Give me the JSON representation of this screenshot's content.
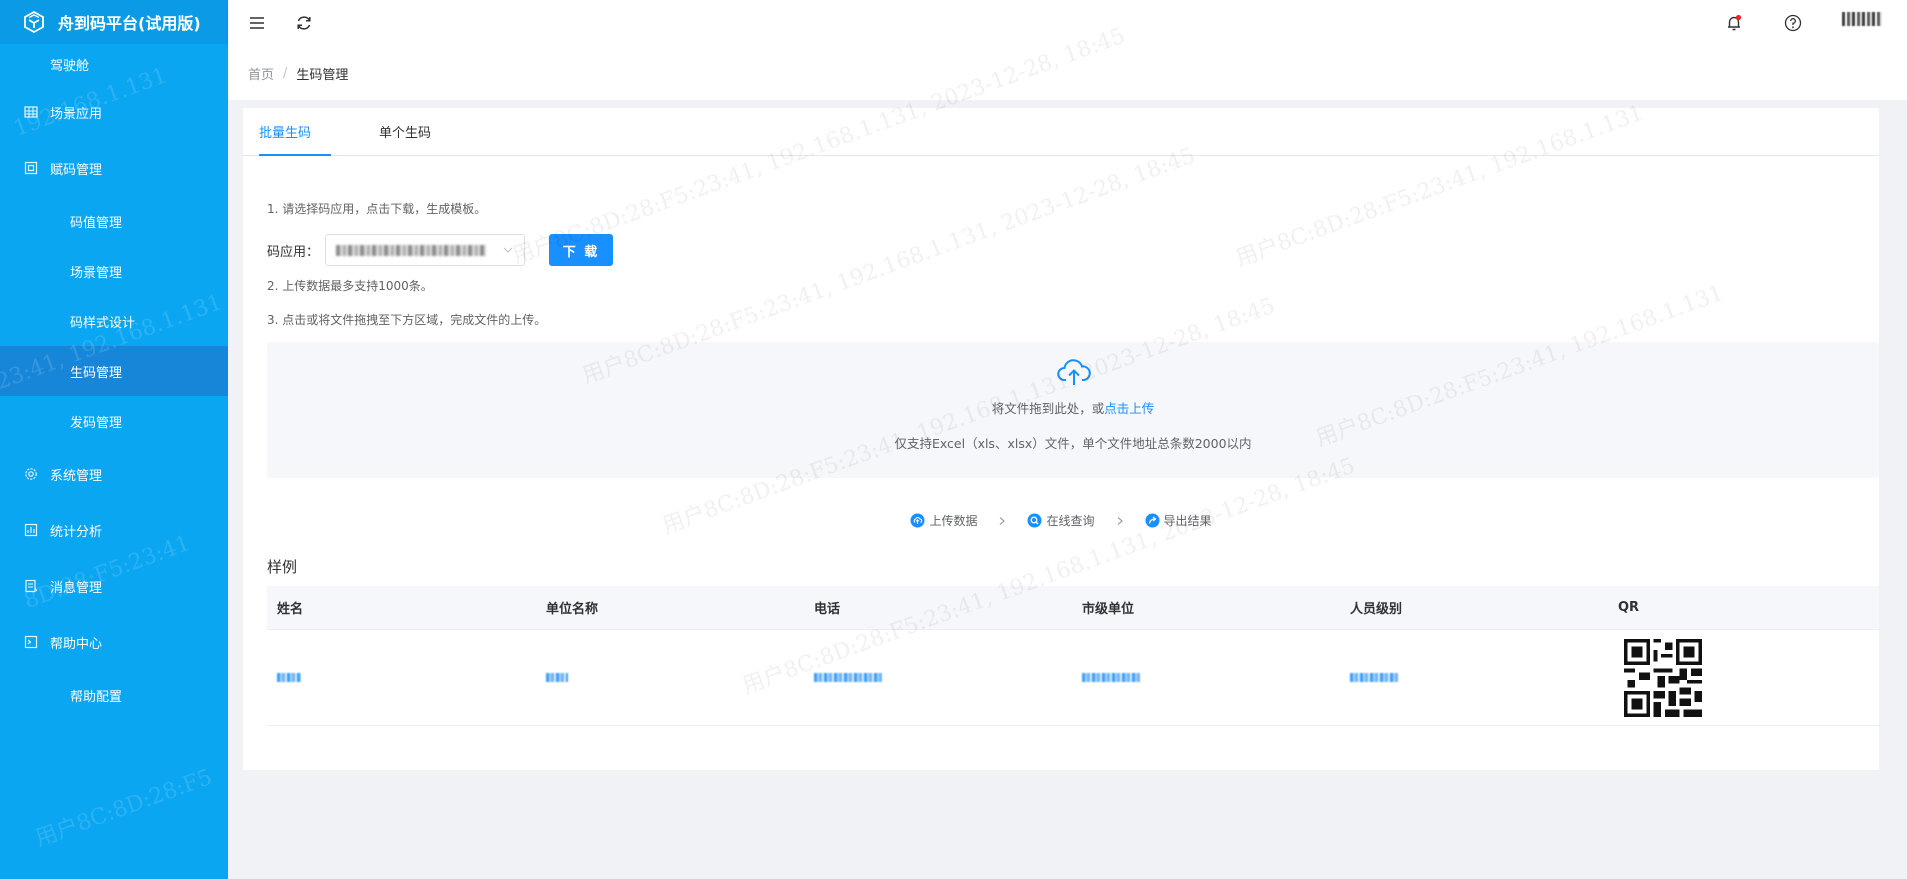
{
  "app": {
    "title": "舟到码平台(试用版)"
  },
  "sidebar": {
    "items": [
      {
        "label": "驾驶舱",
        "level": "top",
        "icon": "none"
      },
      {
        "label": "场景应用",
        "level": "root",
        "icon": "grid-icon"
      },
      {
        "label": "赋码管理",
        "level": "root",
        "icon": "square-icon"
      },
      {
        "label": "码值管理",
        "level": "sub"
      },
      {
        "label": "场景管理",
        "level": "sub"
      },
      {
        "label": "码样式设计",
        "level": "sub"
      },
      {
        "label": "生码管理",
        "level": "sub",
        "active": true
      },
      {
        "label": "发码管理",
        "level": "sub"
      },
      {
        "label": "系统管理",
        "level": "root",
        "icon": "gear-icon"
      },
      {
        "label": "统计分析",
        "level": "root",
        "icon": "chart-icon"
      },
      {
        "label": "消息管理",
        "level": "root",
        "icon": "message-icon"
      },
      {
        "label": "帮助中心",
        "level": "root",
        "icon": "terminal-icon"
      },
      {
        "label": "帮助配置",
        "level": "sub"
      }
    ]
  },
  "breadcrumb": {
    "home": "首页",
    "separator": "/",
    "current": "生码管理"
  },
  "tabs": [
    {
      "label": "批量生码",
      "active": true
    },
    {
      "label": "单个生码",
      "active": false
    }
  ],
  "steps": {
    "s1": "1. 请选择码应用，点击下载，生成模板。",
    "app_label": "码应用：",
    "download": "下 载",
    "s2": "2. 上传数据最多支持1000条。",
    "s3": "3. 点击或将文件拖拽至下方区域，完成文件的上传。"
  },
  "upload": {
    "drag_text": "将文件拖到此处，或",
    "click_text": "点击上传",
    "hint": "仅支持Excel（xls、xlsx）文件，单个文件地址总条数2000以内"
  },
  "flow": [
    {
      "label": "上传数据",
      "icon": "upload-circle-icon"
    },
    {
      "label": "在线查询",
      "icon": "search-circle-icon"
    },
    {
      "label": "导出结果",
      "icon": "export-circle-icon"
    }
  ],
  "sample": {
    "title": "样例",
    "columns": [
      "姓名",
      "单位名称",
      "电话",
      "市级单位",
      "人员级别",
      "QR"
    ]
  },
  "colors": {
    "sidebar": "#0aa6f2",
    "active": "#1786d8",
    "primary": "#1890ff"
  }
}
